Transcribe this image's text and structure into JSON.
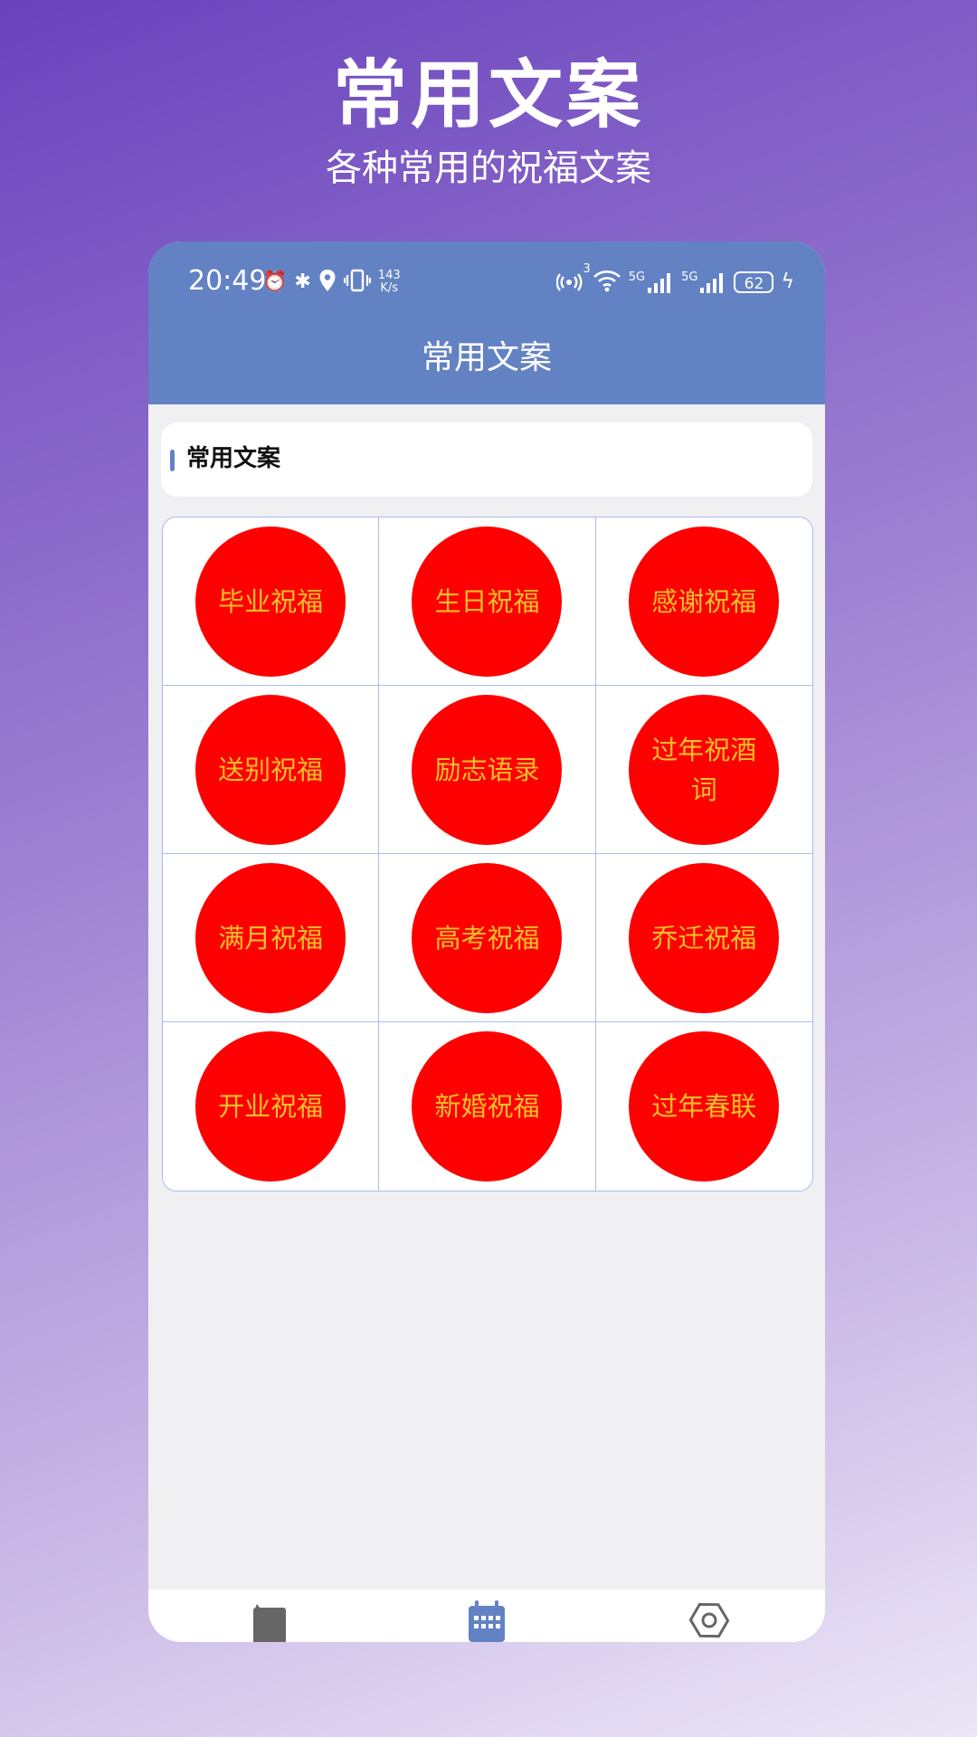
{
  "hero": {
    "title": "常用文案",
    "subtitle": "各种常用的祝福文案"
  },
  "status_bar": {
    "time": "20:49",
    "net_speed_value": "143",
    "net_speed_unit": "K/s",
    "hotspot_count": "3",
    "signal_1_label": "5G",
    "signal_2_label": "5G",
    "battery": "62"
  },
  "app": {
    "title": "常用文案",
    "section_label": "常用文案",
    "items": [
      {
        "label": "毕业祝福"
      },
      {
        "label": "生日祝福"
      },
      {
        "label": "感谢祝福"
      },
      {
        "label": "送别祝福"
      },
      {
        "label": "励志语录"
      },
      {
        "label": "过年祝酒词"
      },
      {
        "label": "满月祝福"
      },
      {
        "label": "高考祝福"
      },
      {
        "label": "乔迁祝福"
      },
      {
        "label": "开业祝福"
      },
      {
        "label": "新婚祝福"
      },
      {
        "label": "过年春联"
      }
    ]
  },
  "bottom_nav": {
    "items": [
      {
        "icon": "book-icon"
      },
      {
        "icon": "calendar-icon"
      },
      {
        "icon": "settings-icon"
      }
    ],
    "active_color": "#6382c3",
    "inactive_color": "#666666"
  },
  "colors": {
    "accent": "#6382c3",
    "circle": "#ff0000",
    "circle_text": "#f4c028",
    "grid_border": "#a9bde8"
  }
}
